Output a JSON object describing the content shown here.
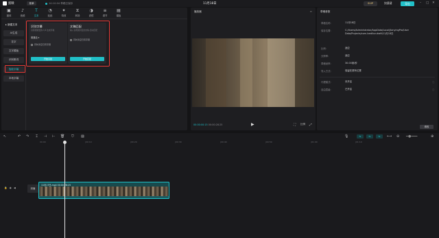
{
  "topbar": {
    "app_name": "剪映",
    "menu_label": "菜单",
    "save_status": "14:10:04 草稿已保存",
    "title": "11月18日",
    "pro_label": "SVIP",
    "shortcut_label": "快捷键",
    "export_label": "导出"
  },
  "toolbar": {
    "items": [
      {
        "label": "媒体",
        "icon": "folder-icon"
      },
      {
        "label": "音频",
        "icon": "music-icon"
      },
      {
        "label": "文本",
        "icon": "text-icon"
      },
      {
        "label": "贴纸",
        "icon": "sticker-icon"
      },
      {
        "label": "特效",
        "icon": "effects-icon"
      },
      {
        "label": "转场",
        "icon": "transition-icon"
      },
      {
        "label": "滤镜",
        "icon": "filter-icon"
      },
      {
        "label": "调节",
        "icon": "adjust-icon"
      },
      {
        "label": "模板",
        "icon": "template-icon"
      }
    ],
    "active_index": 2
  },
  "sidebar": {
    "head": "▸ 新建文本",
    "items": [
      "AI生成",
      "花字",
      "文字模板",
      "识别歌词",
      "智能字幕",
      "本地字幕"
    ],
    "active_index": 4
  },
  "cards": [
    {
      "title": "识别字幕",
      "desc": "识别视频里的人声,生成字幕",
      "select_label": "普通话  ▾",
      "checkbox_label": "同时清空已有字幕",
      "button": "开始识别"
    },
    {
      "title": "文稿匹配",
      "desc": "输入音视频对应的文稿,自动匹配",
      "select_label": "",
      "checkbox_label": "同时清空已有字幕",
      "button": "开始匹配"
    }
  ],
  "player": {
    "header": "播放器",
    "current_time": "00:00:00:15",
    "total_time": "00:00:28:25",
    "ratio_label": "比例"
  },
  "details": {
    "header": "草稿参数",
    "rows": [
      {
        "label": "草稿名称:",
        "value": "11月18日"
      },
      {
        "label": "保存位置:",
        "value": "C:/Users/Administrator/AppData/Local/JianyingPro/User Data/Projects/com.lveditor.draft/11月18日"
      },
      {
        "label": "比例:",
        "value": "适应"
      },
      {
        "label": "分辨率:",
        "value": "适应"
      },
      {
        "label": "草稿帧率:",
        "value": "30.00帧/秒"
      },
      {
        "label": "导入方式:",
        "value": "保留在原有位置"
      },
      {
        "label": "代理模式:",
        "value": "未开启"
      },
      {
        "label": "自由层级:",
        "value": "已开启"
      }
    ],
    "modify_label": "修改"
  },
  "timeline": {
    "ruler": [
      "00:00",
      "|00:10",
      "|00:20",
      "|00:30",
      "|00:40",
      "|00:50",
      "|01:00",
      "|01:10"
    ],
    "clip_label": "11月17日.mp4  00:00:28:25",
    "cover_label": "封面"
  }
}
